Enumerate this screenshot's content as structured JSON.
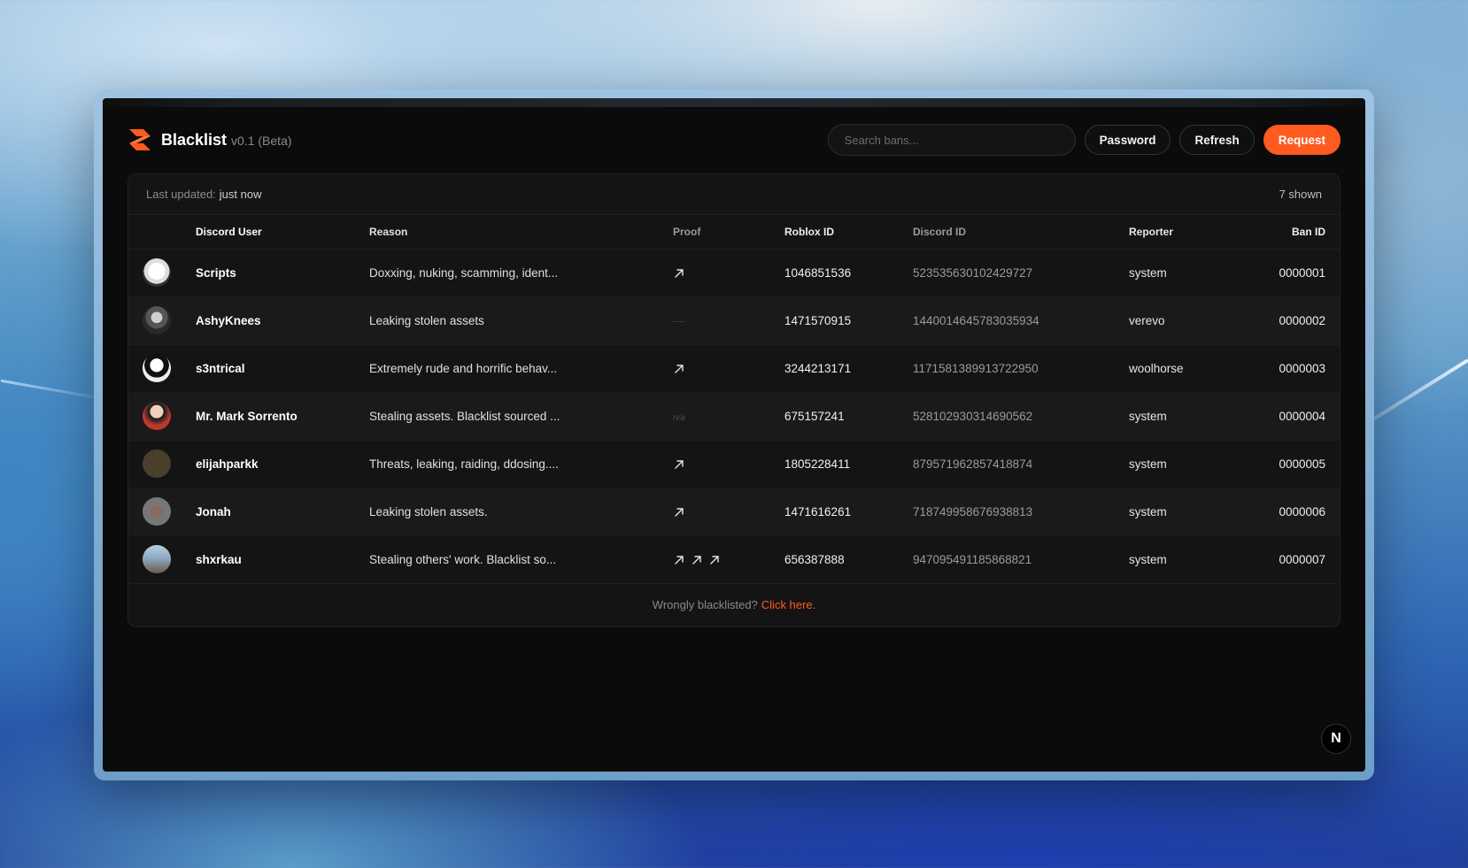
{
  "app": {
    "name": "Blacklist",
    "version": "v0.1 (Beta)"
  },
  "header": {
    "search_placeholder": "Search bans...",
    "password_label": "Password",
    "refresh_label": "Refresh",
    "request_label": "Request"
  },
  "status": {
    "last_updated_label": "Last updated:",
    "last_updated_value": "just now",
    "shown_count": "7 shown"
  },
  "table": {
    "columns": [
      "Discord User",
      "Reason",
      "Proof",
      "Roblox ID",
      "Discord ID",
      "Reporter",
      "Ban ID"
    ],
    "rows": [
      {
        "user": "Scripts",
        "reason": "Doxxing, nuking, scamming, ident...",
        "proof": [
          "link"
        ],
        "roblox_id": "1046851536",
        "discord_id": "523535630102429727",
        "reporter": "system",
        "ban_id": "0000001"
      },
      {
        "user": "AshyKnees",
        "reason": "Leaking stolen assets",
        "proof": "—",
        "roblox_id": "1471570915",
        "discord_id": "1440014645783035934",
        "reporter": "verevo",
        "ban_id": "0000002"
      },
      {
        "user": "s3ntrical",
        "reason": "Extremely rude and horrific behav...",
        "proof": [
          "link"
        ],
        "roblox_id": "3244213171",
        "discord_id": "1171581389913722950",
        "reporter": "woolhorse",
        "ban_id": "0000003"
      },
      {
        "user": "Mr. Mark Sorrento",
        "reason": "Stealing assets. Blacklist sourced ...",
        "proof": "n/a",
        "roblox_id": "675157241",
        "discord_id": "528102930314690562",
        "reporter": "system",
        "ban_id": "0000004"
      },
      {
        "user": "elijahparkk",
        "reason": "Threats, leaking, raiding, ddosing....",
        "proof": [
          "link"
        ],
        "roblox_id": "1805228411",
        "discord_id": "879571962857418874",
        "reporter": "system",
        "ban_id": "0000005"
      },
      {
        "user": "Jonah",
        "reason": "Leaking stolen assets.",
        "proof": [
          "link"
        ],
        "roblox_id": "1471616261",
        "discord_id": "718749958676938813",
        "reporter": "system",
        "ban_id": "0000006"
      },
      {
        "user": "shxrkau",
        "reason": "Stealing others' work. Blacklist so...",
        "proof": [
          "link",
          "link",
          "link"
        ],
        "roblox_id": "656387888",
        "discord_id": "947095491185868821",
        "reporter": "system",
        "ban_id": "0000007"
      }
    ]
  },
  "footer": {
    "text": "Wrongly blacklisted?",
    "link": "Click here",
    "end": "."
  },
  "badge": "N",
  "colors": {
    "accent": "#ff5a1f",
    "background": "#0b0b0b",
    "card": "#141414"
  }
}
